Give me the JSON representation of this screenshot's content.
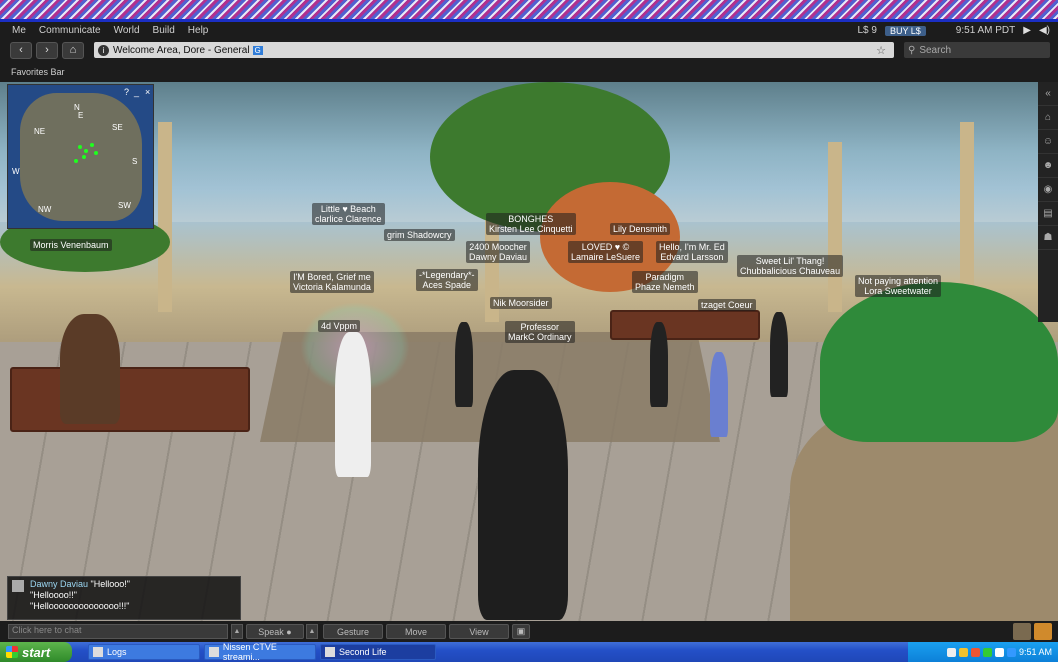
{
  "menu": {
    "items": [
      "Me",
      "Communicate",
      "World",
      "Build",
      "Help"
    ],
    "balance": "L$ 9",
    "buy_label": "BUY L$",
    "clock": "9:51 AM PDT"
  },
  "nav": {
    "back_icon": "back-icon",
    "forward_icon": "forward-icon",
    "home_icon": "home-icon",
    "location": "Welcome Area, Dore - General",
    "rating_badge": "G",
    "search_placeholder": "Search"
  },
  "favorites": {
    "label": "Favorites Bar"
  },
  "minimap": {
    "labels": {
      "n": "N",
      "ne": "NE",
      "e": "E",
      "se": "SE",
      "s": "S",
      "sw": "SW",
      "w": "W",
      "nw": "NW"
    },
    "help": "?",
    "minimize": "_",
    "close": "×"
  },
  "name_tags": [
    "Morris Venenbaum",
    "Little ♥ Beach\nclarlice Clarence",
    "grim Shadowcry",
    "BONGHES\nKirsten Lee Cinquetti",
    "Lily Densmith",
    "2400 Moocher\nDawny Daviau",
    "LOVED ♥ ©\nLamaire LeSuere",
    "Hello, I'm Mr. Ed\nEdvard Larsson",
    "Sweet Lil' Thang!\nChubbalicious Chauveau",
    "Not paying attention\nLora Sweetwater",
    "I'M Bored, Grief me\nVictoria Kalamunda",
    "-*Legendary*-\nAces Spade",
    "Paradigm\nPhaze Nemeth",
    "Nik Moorsider",
    "tzaget Coeur",
    "4d Vppm",
    "Professor\nMarkC Ordinary"
  ],
  "chat_log": {
    "speaker": "Dawny Daviau",
    "lines": [
      "\"Hellooo!\"",
      "\"Helloooo!!\"",
      "\"Helloooooooooooooo!!!\""
    ]
  },
  "bottom_bar": {
    "chat_placeholder": "Click here to chat",
    "speak": "Speak",
    "gesture": "Gesture",
    "move": "Move",
    "view": "View"
  },
  "taskbar": {
    "start": "start",
    "tasks": [
      "Logs",
      "Nissen CTVE streami...",
      "Second Life"
    ],
    "clock": "9:51 AM"
  },
  "colors": {
    "chat_name": "#9cd7f2",
    "purple_tag": "#c98cff",
    "taskbar_blue": "#2450c8",
    "start_green": "#3a9a32"
  }
}
